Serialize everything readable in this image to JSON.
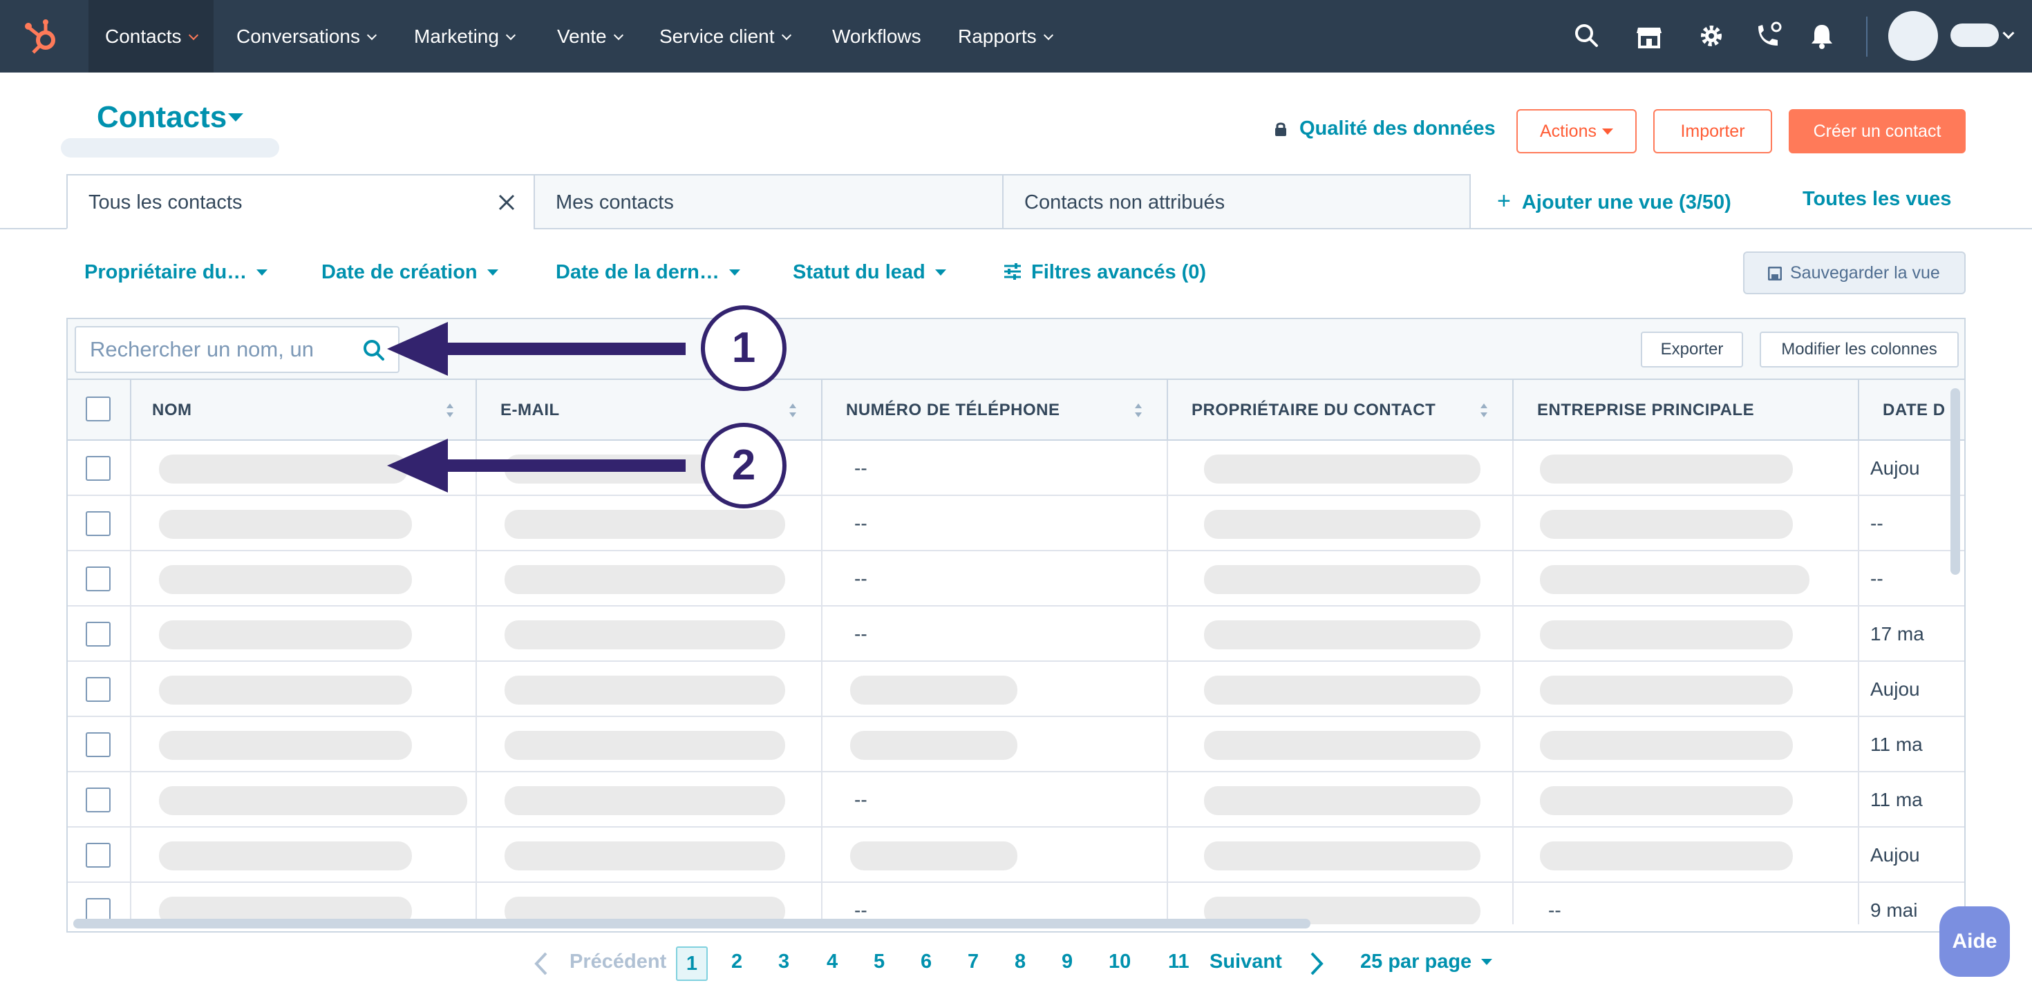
{
  "nav": {
    "items": [
      {
        "label": "Contacts",
        "has_chevron": true,
        "active": true
      },
      {
        "label": "Conversations",
        "has_chevron": true
      },
      {
        "label": "Marketing",
        "has_chevron": true
      },
      {
        "label": "Vente",
        "has_chevron": true
      },
      {
        "label": "Service client",
        "has_chevron": true
      },
      {
        "label": "Workflows",
        "has_chevron": false
      },
      {
        "label": "Rapports",
        "has_chevron": true
      }
    ],
    "icons": [
      "search-icon",
      "marketplace-icon",
      "settings-icon",
      "calling-icon",
      "notifications-icon"
    ],
    "accent": "#ff7a59",
    "background": "#2d3e50"
  },
  "header": {
    "title": "Contacts",
    "data_quality": "Qualité des données",
    "actions_label": "Actions",
    "import_label": "Importer",
    "create_label": "Créer un contact"
  },
  "views": {
    "tabs": [
      {
        "label": "Tous les contacts",
        "active": true
      },
      {
        "label": "Mes contacts"
      },
      {
        "label": "Contacts non attribués"
      }
    ],
    "add_view": "Ajouter une vue (3/50)",
    "all_views": "Toutes les vues"
  },
  "filters": {
    "items": [
      "Propriétaire du…",
      "Date de création",
      "Date de la dern…",
      "Statut du lead"
    ],
    "advanced": "Filtres avancés (0)",
    "save_view": "Sauvegarder la vue"
  },
  "table": {
    "search_placeholder": "Rechercher un nom, un",
    "export_label": "Exporter",
    "edit_columns_label": "Modifier les colonnes",
    "columns": [
      "NOM",
      "E-MAIL",
      "NUMÉRO DE TÉLÉPHONE",
      "PROPRIÉTAIRE DU CONTACT",
      "ENTREPRISE PRINCIPALE",
      "DATE D"
    ],
    "empty_value": "--",
    "rows": [
      {
        "phone": "--",
        "company": "",
        "date": "Aujou"
      },
      {
        "phone": "--",
        "company": "",
        "date": "--"
      },
      {
        "phone": "--",
        "company": "",
        "date": "--"
      },
      {
        "phone": "--",
        "company": "",
        "date": "17 ma"
      },
      {
        "phone": "",
        "company": "",
        "date": "Aujou"
      },
      {
        "phone": "",
        "company": "",
        "date": "11 ma"
      },
      {
        "phone": "--",
        "company": "",
        "date": "11 ma"
      },
      {
        "phone": "",
        "company": "",
        "date": "Aujou"
      },
      {
        "phone": "--",
        "company": "--",
        "date": "9 mai"
      }
    ]
  },
  "annotations": [
    {
      "number": "1",
      "target": "search-box"
    },
    {
      "number": "2",
      "target": "name-column"
    }
  ],
  "annotation_color": "#33236e",
  "pagination": {
    "prev": "Précédent",
    "next": "Suivant",
    "current": "1",
    "pages": [
      "2",
      "3",
      "4",
      "5",
      "6",
      "7",
      "8",
      "9",
      "10",
      "11"
    ],
    "per_page": "25 par page"
  },
  "help": "Aide"
}
